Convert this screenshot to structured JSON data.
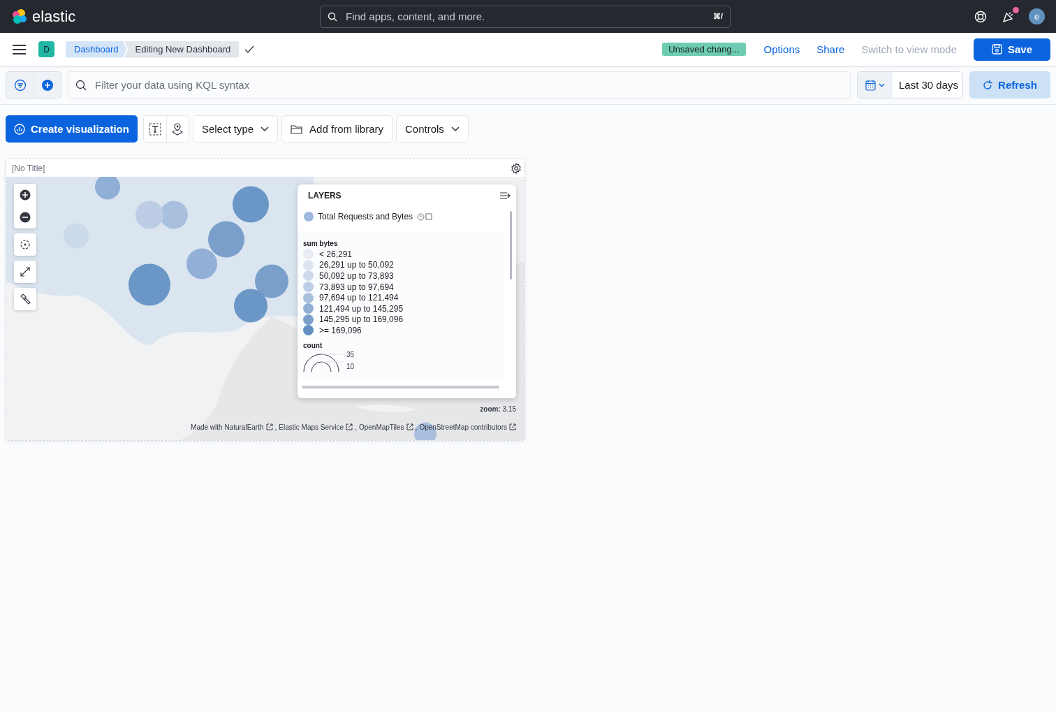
{
  "header": {
    "logo_text": "elastic",
    "search": {
      "placeholder": "Find apps, content, and more.",
      "shortcut": "⌘/"
    },
    "news_unread": true,
    "avatar": "e"
  },
  "app_bar": {
    "space_badge": "D",
    "breadcrumbs": [
      {
        "label": "Dashboard",
        "selected": false
      },
      {
        "label": "Editing New Dashboard",
        "selected": true
      }
    ],
    "status_badge": "Unsaved chang...",
    "menu": [
      {
        "label": "Options",
        "disabled": false
      },
      {
        "label": "Share",
        "disabled": false
      },
      {
        "label": "Switch to view mode",
        "disabled": true
      }
    ],
    "save_button": "Save"
  },
  "query_bar": {
    "placeholder": "Filter your data using KQL syntax",
    "time_range": "Last 30 days",
    "refresh_button": "Refresh"
  },
  "toolbar": {
    "create_button": "Create visualization",
    "select_type": "Select type",
    "library_button": "Add from library",
    "controls_button": "Controls"
  },
  "panel": {
    "title": "[No Title]",
    "layers": {
      "title": "LAYERS",
      "layer": {
        "name": "Total Requests and Bytes",
        "color": "#9db7dd"
      },
      "legend_title": "sum bytes",
      "legend": [
        {
          "label": "< 26,291",
          "color": "#e9edf3"
        },
        {
          "label": "26,291 up to 50,092",
          "color": "#dce4ef"
        },
        {
          "label": "50,092 up to 73,893",
          "color": "#cddaeb"
        },
        {
          "label": "73,893 up to 97,694",
          "color": "#bccde5"
        },
        {
          "label": "97,694 up to 121,494",
          "color": "#a8c0de"
        },
        {
          "label": "121,494 up to 145,295",
          "color": "#92b0d5"
        },
        {
          "label": "145,295 up to 169,096",
          "color": "#7a9fcb"
        },
        {
          "label": ">= 169,096",
          "color": "#6490c1"
        }
      ],
      "size_title": "count",
      "size_labels": [
        "35",
        "10"
      ]
    },
    "zoom": "**zoom:** 3.15",
    "attribution": [
      {
        "label": "Made with NaturalEarth",
        "separator": ","
      },
      {
        "label": "Elastic Maps Service",
        "separator": ","
      },
      {
        "label": "OpenMapTiles",
        "separator": ","
      },
      {
        "label": "OpenStreetMap contributors"
      }
    ]
  }
}
